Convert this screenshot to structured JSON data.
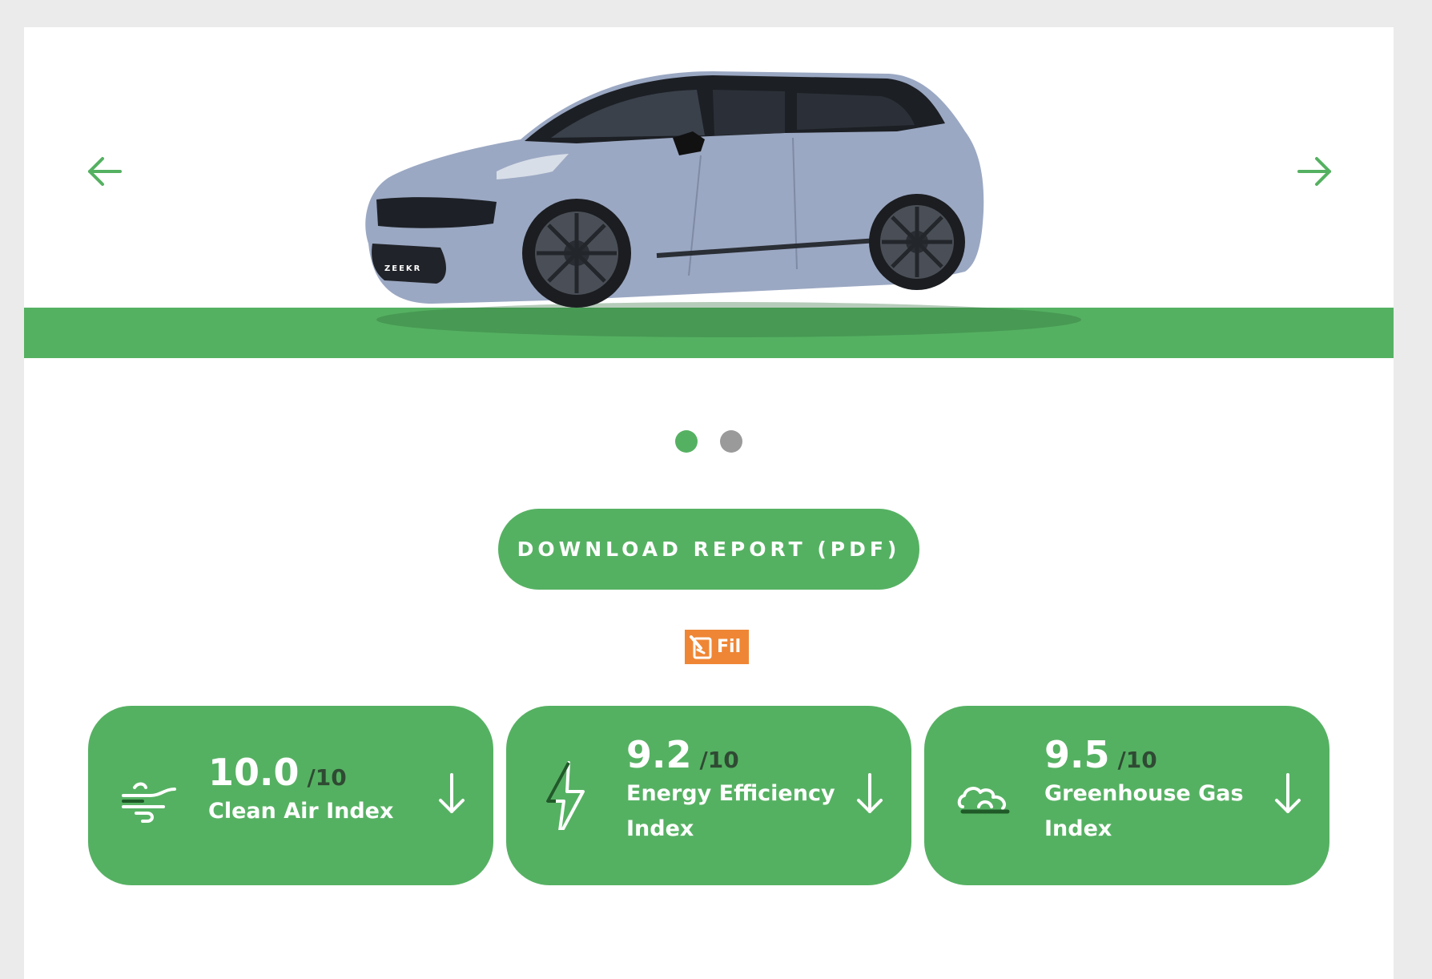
{
  "hero": {
    "prev_arrow_icon": "arrow-left-icon",
    "next_arrow_icon": "arrow-right-icon",
    "car_badge": "ZEEKR",
    "accent_color": "#55b162"
  },
  "carousel": {
    "slide_count": 2,
    "active_index": 0
  },
  "download": {
    "label": "DOWNLOAD REPORT (PDF)"
  },
  "file_badge": {
    "label": "Fil",
    "icon": "pdf-file-icon",
    "color": "#ef8635"
  },
  "indices": [
    {
      "icon": "wind-icon",
      "score": "10.0",
      "max": "/10",
      "label": "Clean Air Index"
    },
    {
      "icon": "lightning-icon",
      "score": "9.2",
      "max": "/10",
      "label": "Energy Efficiency Index"
    },
    {
      "icon": "cloud-icon",
      "score": "9.5",
      "max": "/10",
      "label": "Greenhouse Gas Index"
    }
  ]
}
